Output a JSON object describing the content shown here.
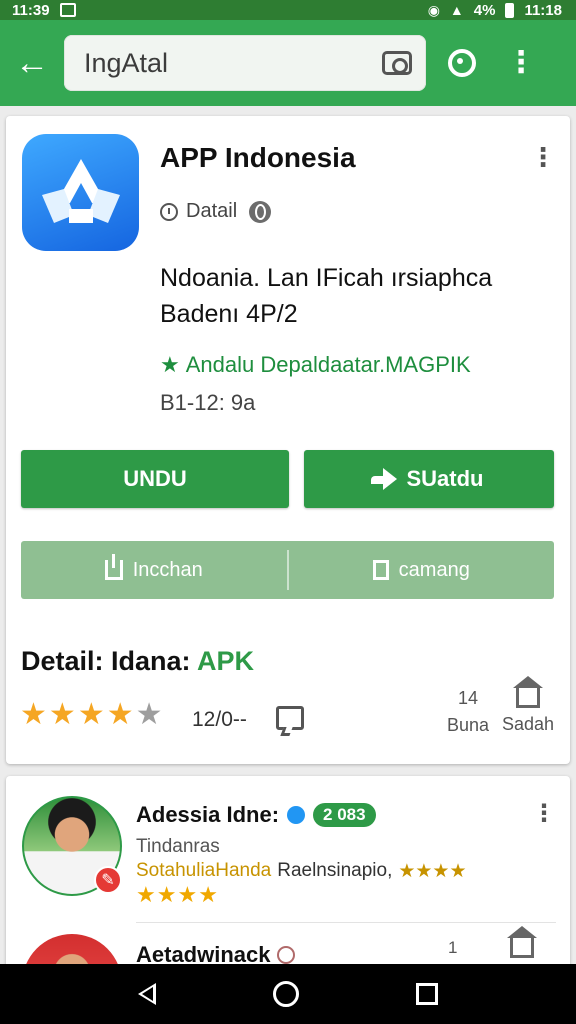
{
  "status_bar": {
    "time_left": "11:39",
    "battery_percent": "4%",
    "time_right": "11:18"
  },
  "app_bar": {
    "search": {
      "value": "IngAtal",
      "placeholder": "IngAtal"
    },
    "icons": [
      "back-arrow-icon",
      "camera-icon",
      "feedback-icon",
      "overflow-menu-icon"
    ]
  },
  "app_card": {
    "name": "APP Indonesia",
    "detail_label": "Datail",
    "description_line1": "Ndoania. Lan IFicah ırsiaphca",
    "description_line2": "Badenı 4P/2",
    "developer": "Andalu Depaldaatar.MAGPIK",
    "date": "B1-12: 9a",
    "primary_button": "UNDU",
    "share_button": "SUatdu",
    "secondary_left": "Incchan",
    "secondary_right": "camang",
    "detail_title_prefix": "Detail: Idana: ",
    "detail_title_accent": "APK",
    "rating_value": 4.5,
    "review_count": "12/0--",
    "stat1_value": "14",
    "stat1_label": "Buna",
    "stat2_label": "Sadah"
  },
  "review_card": {
    "reviewer_name": "Adessia Idne:",
    "badge": "2 083",
    "subtitle": "Tindanras",
    "text_highlight": "SotahuliaHanda",
    "text_dark": "Raelnsinapio,",
    "second_reviewer": "Aetadwinack",
    "stat1_value": "1"
  },
  "colors": {
    "appbar": "#34a853",
    "statusbar": "#2e7d32",
    "primary_green": "#2e9a47",
    "light_green": "#8fbf92",
    "star": "#f5a623"
  }
}
